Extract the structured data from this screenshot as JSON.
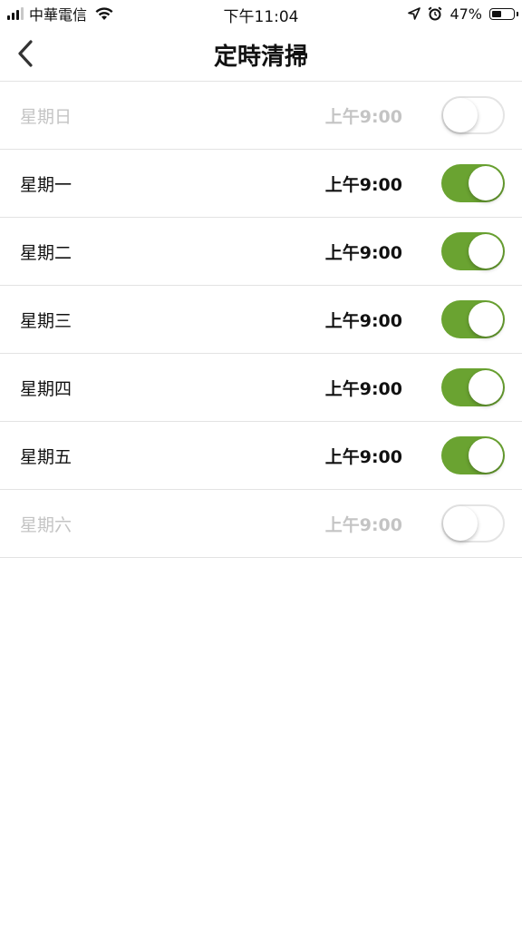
{
  "status_bar": {
    "carrier": "中華電信",
    "time": "下午11:04",
    "battery_percent": "47%",
    "battery_level": 0.47,
    "icons": [
      "signal-icon",
      "wifi-icon",
      "location-arrow-icon",
      "alarm-icon",
      "battery-icon"
    ]
  },
  "header": {
    "title": "定時清掃",
    "back_icon": "chevron-left-icon"
  },
  "schedule": [
    {
      "day": "星期日",
      "time": "上午9:00",
      "enabled": false
    },
    {
      "day": "星期一",
      "time": "上午9:00",
      "enabled": true
    },
    {
      "day": "星期二",
      "time": "上午9:00",
      "enabled": true
    },
    {
      "day": "星期三",
      "time": "上午9:00",
      "enabled": true
    },
    {
      "day": "星期四",
      "time": "上午9:00",
      "enabled": true
    },
    {
      "day": "星期五",
      "time": "上午9:00",
      "enabled": true
    },
    {
      "day": "星期六",
      "time": "上午9:00",
      "enabled": false
    }
  ],
  "colors": {
    "toggle_on": "#6aa331",
    "toggle_off_border": "#e4e4e4",
    "disabled_text": "#c4c4c4",
    "divider": "#e3e3e3"
  }
}
